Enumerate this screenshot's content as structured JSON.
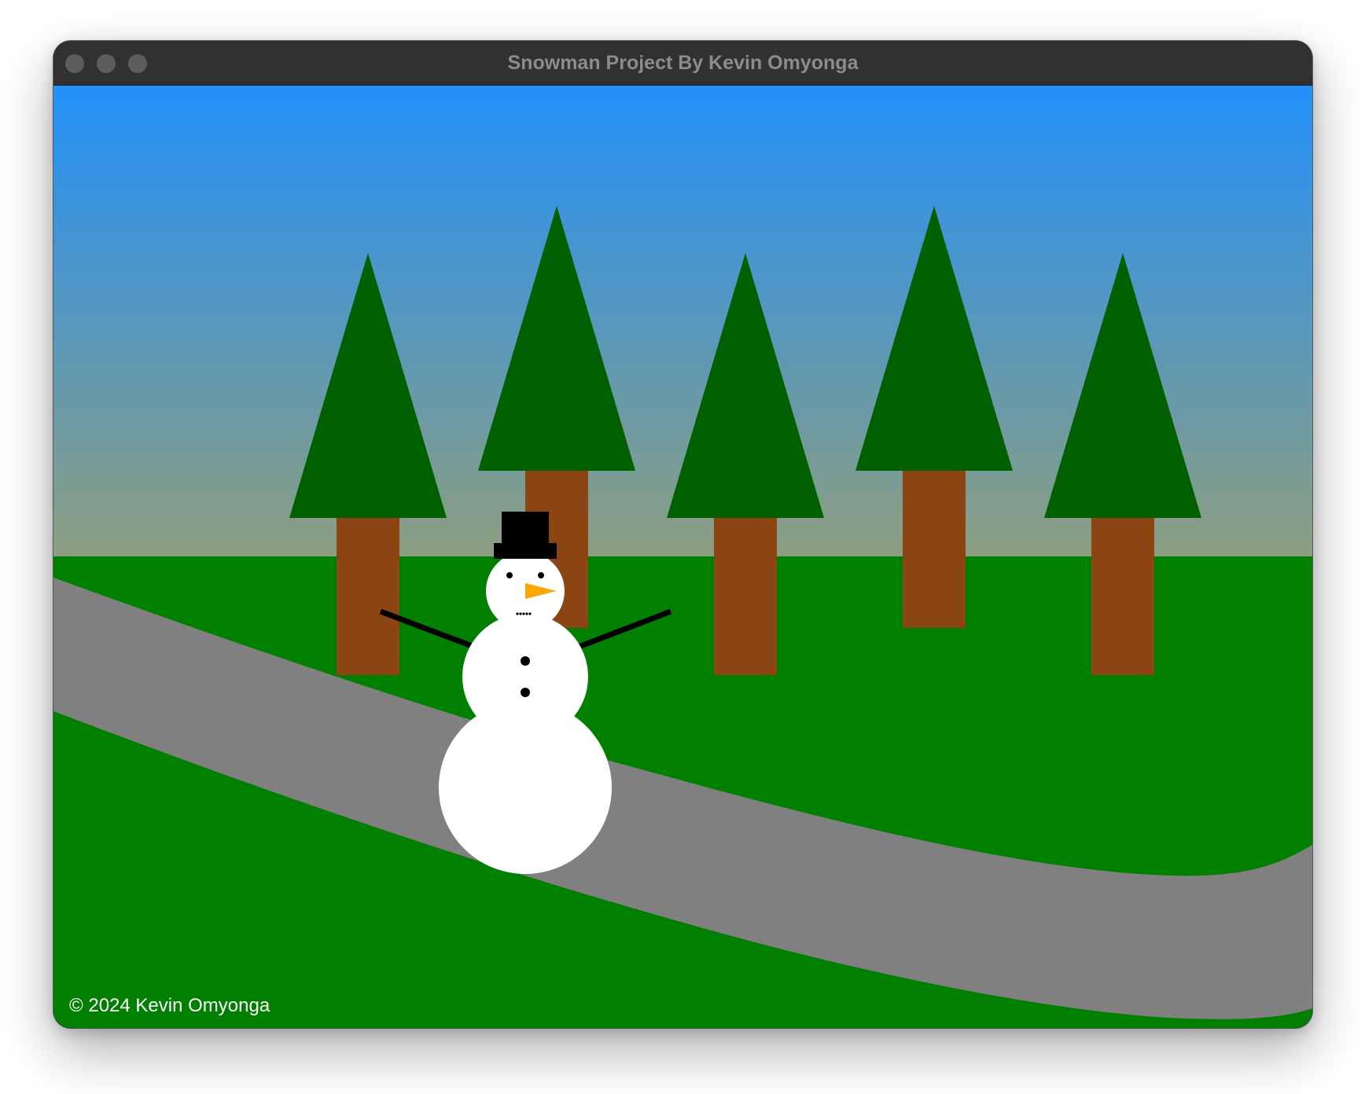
{
  "window": {
    "title": "Snowman Project By Kevin Omyonga"
  },
  "scene": {
    "colors": {
      "sky_top": "#2291FA",
      "sky_bottom": "#8C9E80",
      "grass": "#007F00",
      "path": "#808080",
      "tree_foliage": "#006000",
      "tree_trunk": "#8B4513",
      "snow": "#FFFFFF",
      "hat": "#000000",
      "nose": "#FFA500",
      "arm": "#000000"
    },
    "trees": [
      {
        "name": "tree-1"
      },
      {
        "name": "tree-2"
      },
      {
        "name": "tree-3"
      },
      {
        "name": "tree-4"
      },
      {
        "name": "tree-5"
      }
    ],
    "snowman": {
      "buttons": 2,
      "eyes": 2
    }
  },
  "footer": {
    "copyright": "© 2024 Kevin Omyonga"
  }
}
